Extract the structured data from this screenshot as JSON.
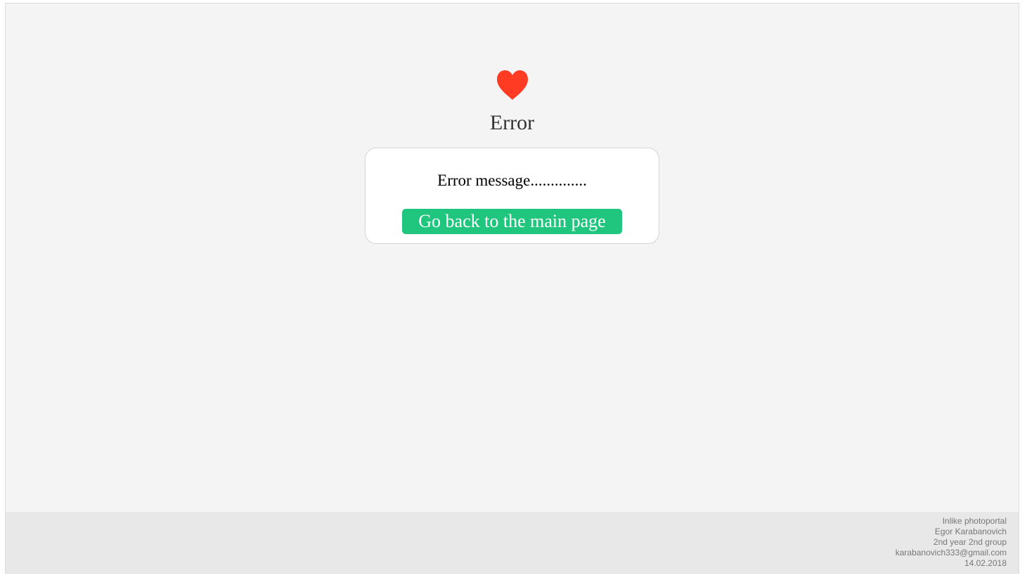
{
  "page": {
    "title": "Error",
    "icon": "heart-icon",
    "icon_color": "#ff3b24"
  },
  "card": {
    "message": "Error message..............",
    "back_button_label": "Go back to the main page",
    "button_color": "#21c67e"
  },
  "footer": {
    "lines": [
      "Inlike photoportal",
      "Egor Karabanovich",
      "2nd year 2nd group",
      "karabanovich333@gmail.com",
      "14.02.2018"
    ]
  }
}
